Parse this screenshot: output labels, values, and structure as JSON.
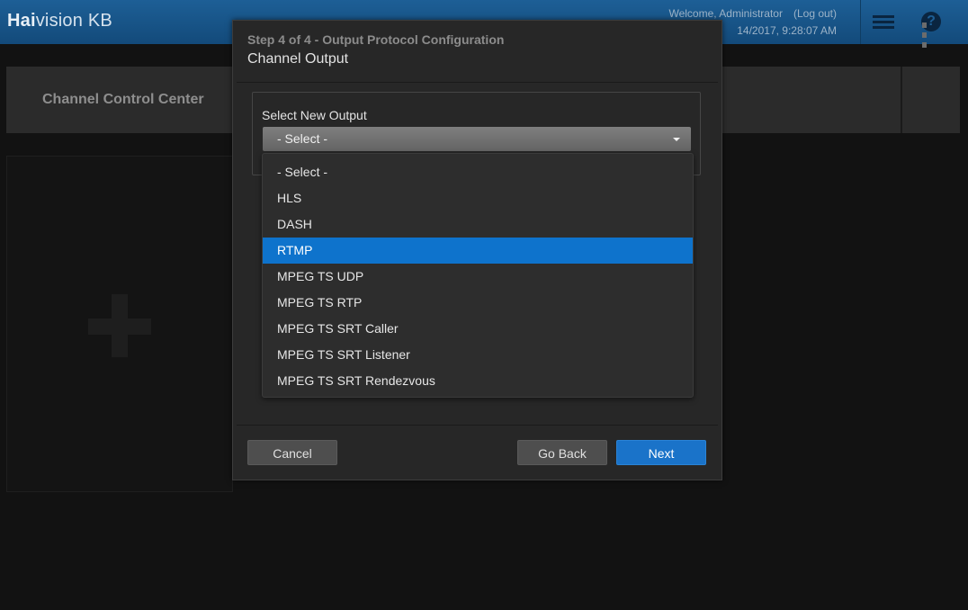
{
  "header": {
    "logo_prefix": "Hai",
    "logo_suffix": "vision KB",
    "welcome": "Welcome, Administrator",
    "logout": "(Log out)",
    "datetime": "14/2017, 9:28:07 AM",
    "help_glyph": "?",
    "icons": {
      "menu": "hamburger-icon",
      "help": "help-icon"
    }
  },
  "page": {
    "title": "Channel Control Center",
    "icons": {
      "more": "kebab-icon",
      "add": "plus-icon"
    }
  },
  "modal": {
    "step": "Step 4 of 4 - Output Protocol Configuration",
    "title": "Channel Output",
    "field_label": "Select New Output",
    "select_value": "- Select -",
    "options": [
      "- Select -",
      "HLS",
      "DASH",
      "RTMP",
      "MPEG TS UDP",
      "MPEG TS RTP",
      "MPEG TS SRT Caller",
      "MPEG TS SRT Listener",
      "MPEG TS SRT Rendezvous"
    ],
    "highlighted_option": "RTMP",
    "buttons": {
      "cancel": "Cancel",
      "back": "Go Back",
      "next": "Next"
    }
  },
  "colors": {
    "header_blue": "#1d5f96",
    "accent": "#1a73c9",
    "highlight": "#0e73cc",
    "background": "#121212"
  }
}
